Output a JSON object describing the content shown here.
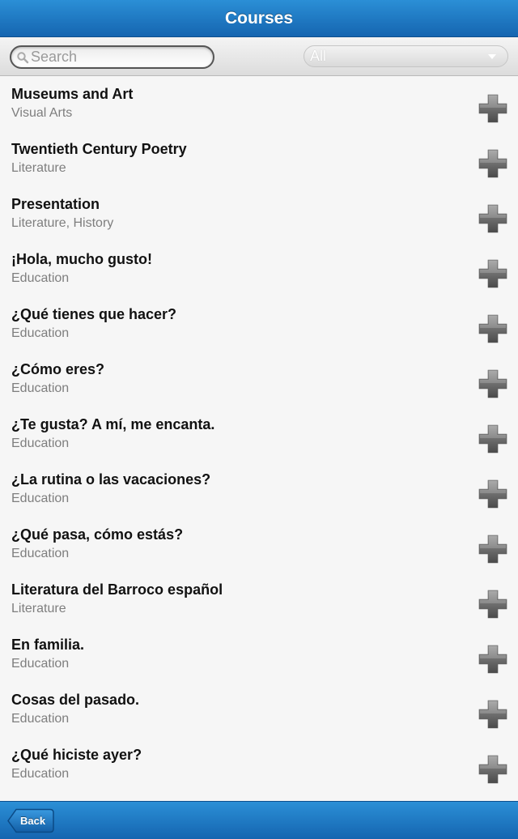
{
  "header": {
    "title": "Courses"
  },
  "toolbar": {
    "search_placeholder": "Search",
    "filter_value": "All"
  },
  "courses": [
    {
      "name": "Museums and Art",
      "category": "Visual Arts"
    },
    {
      "name": "Twentieth Century Poetry",
      "category": "Literature"
    },
    {
      "name": "Presentation",
      "category": "Literature, History"
    },
    {
      "name": "¡Hola, mucho gusto!",
      "category": "Education"
    },
    {
      "name": "¿Qué tienes que hacer?",
      "category": "Education"
    },
    {
      "name": "¿Cómo eres?",
      "category": "Education"
    },
    {
      "name": "¿Te gusta? A mí, me encanta.",
      "category": "Education"
    },
    {
      "name": "¿La rutina o las vacaciones?",
      "category": "Education"
    },
    {
      "name": "¿Qué pasa, cómo estás?",
      "category": "Education"
    },
    {
      "name": "Literatura del Barroco español",
      "category": "Literature"
    },
    {
      "name": "En familia.",
      "category": "Education"
    },
    {
      "name": "Cosas del pasado.",
      "category": "Education"
    },
    {
      "name": "¿Qué hiciste ayer?",
      "category": "Education"
    }
  ],
  "icons": {
    "add": "plus-icon",
    "search": "search-icon",
    "filter": "chevron-down-icon"
  },
  "footer": {
    "back_label": "Back"
  },
  "colors": {
    "bar": "#1a72bf",
    "list_bg": "#f6f6f6",
    "subtitle": "#7e7e7e"
  }
}
